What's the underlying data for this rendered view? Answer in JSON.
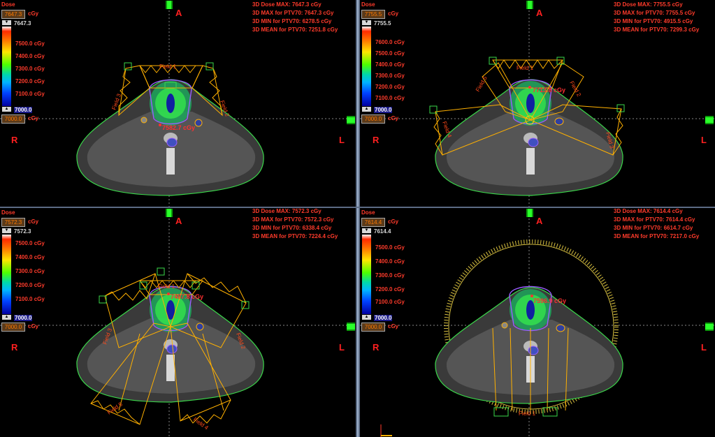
{
  "legend_title": "Dose",
  "unit": "cGy",
  "colorbar_ticks": [
    "7500.0 cGy",
    "7400.0 cGy",
    "7300.0 cGy",
    "7200.0 cGy",
    "7100.0 cGy"
  ],
  "colorbar_ticks_p1": [
    "7600.0 cGy",
    "7500.0 cGy",
    "7400.0 cGy",
    "7300.0 cGy",
    "7200.0 cGy",
    "7100.0 cGy"
  ],
  "colorbar_min": "7000.0",
  "min_box": "7000.0",
  "orientation": {
    "anterior": "A",
    "right": "R",
    "left": "L"
  },
  "colors": {
    "background": "#000000",
    "stat_text": "#ff3b2b",
    "beam": "#ffb000",
    "body_contour": "#3ad84a",
    "ptv": "#9a5cff"
  },
  "panels": [
    {
      "max_box": "7647.3",
      "max_val": "7647.3",
      "stats": [
        "3D Dose MAX: 7647.3 cGy",
        "3D MAX for PTV70: 7647.3 cGy",
        "3D MIN for PTV70: 6278.5 cGy",
        "3D MEAN for PTV70: 7251.8 cGy"
      ],
      "point_label": "7582.7 cGy",
      "fields": [
        "Field 1",
        "Field 2",
        "Field 3"
      ]
    },
    {
      "max_box": "7755.5",
      "max_val": "7755.5",
      "stats": [
        "3D Dose MAX: 7755.5 cGy",
        "3D MAX for PTV70: 7755.5 cGy",
        "3D MIN for PTV70: 4915.5 cGy",
        "3D MEAN for PTV70: 7299.3 cGy"
      ],
      "point_label": "7713.8 cGy",
      "fields": [
        "Field 1",
        "Field 2",
        "Field 3",
        "Field 4",
        "Field 5"
      ]
    },
    {
      "max_box": "7572.3",
      "max_val": "7572.3",
      "stats": [
        "3D Dose MAX: 7572.3 cGy",
        "3D MAX for PTV70: 7572.3 cGy",
        "3D MIN for PTV70: 6338.4 cGy",
        "3D MEAN for PTV70: 7224.4 cGy"
      ],
      "point_label": "7487.8 cGy",
      "fields": [
        "Field 1",
        "Field 2",
        "Field 3",
        "Field 4",
        "Field 5"
      ]
    },
    {
      "max_box": "7614.4",
      "max_val": "7614.4",
      "stats": [
        "3D Dose MAX: 7614.4 cGy",
        "3D MAX for PTV70: 7614.4 cGy",
        "3D MIN for PTV70: 6614.7 cGy",
        "3D MEAN for PTV70: 7217.0 cGy"
      ],
      "point_label": "7596.9 cGy",
      "fields": [
        "Field 1"
      ]
    }
  ]
}
